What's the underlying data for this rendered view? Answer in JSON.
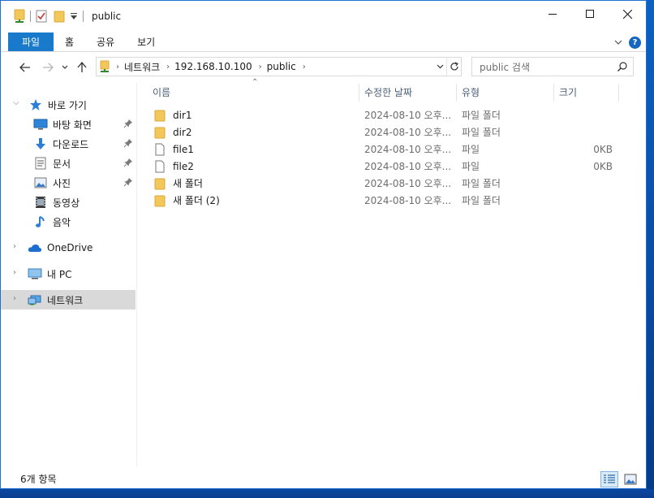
{
  "window": {
    "title": "public"
  },
  "ribbon": {
    "tabs": [
      "파일",
      "홈",
      "공유",
      "보기"
    ],
    "help": "?"
  },
  "address": {
    "crumbs": [
      "네트워크",
      "192.168.10.100",
      "public"
    ]
  },
  "search": {
    "placeholder": "public 검색"
  },
  "sidebar": {
    "quick_access": "바로 가기",
    "quick_items": [
      {
        "label": "바탕 화면",
        "icon": "desktop-icon",
        "pinned": true
      },
      {
        "label": "다운로드",
        "icon": "download-icon",
        "pinned": true
      },
      {
        "label": "문서",
        "icon": "document-icon",
        "pinned": true
      },
      {
        "label": "사진",
        "icon": "pictures-icon",
        "pinned": true
      },
      {
        "label": "동영상",
        "icon": "video-icon",
        "pinned": false
      },
      {
        "label": "음악",
        "icon": "music-icon",
        "pinned": false
      }
    ],
    "onedrive": "OneDrive",
    "this_pc": "내 PC",
    "network": "네트워크"
  },
  "columns": {
    "name": "이름",
    "date": "수정한 날짜",
    "type": "유형",
    "size": "크기"
  },
  "files": [
    {
      "name": "dir1",
      "date": "2024-08-10 오후...",
      "type": "파일 폴더",
      "size": "",
      "kind": "folder"
    },
    {
      "name": "dir2",
      "date": "2024-08-10 오후...",
      "type": "파일 폴더",
      "size": "",
      "kind": "folder"
    },
    {
      "name": "file1",
      "date": "2024-08-10 오후...",
      "type": "파일",
      "size": "0KB",
      "kind": "file"
    },
    {
      "name": "file2",
      "date": "2024-08-10 오후...",
      "type": "파일",
      "size": "0KB",
      "kind": "file"
    },
    {
      "name": "새 폴더",
      "date": "2024-08-10 오후...",
      "type": "파일 폴더",
      "size": "",
      "kind": "folder"
    },
    {
      "name": "새 폴더 (2)",
      "date": "2024-08-10 오후...",
      "type": "파일 폴더",
      "size": "",
      "kind": "folder"
    }
  ],
  "status": {
    "count": "6개 항목"
  },
  "colors": {
    "accent": "#1979ca",
    "folder": "#f3c85a",
    "selected": "#d9d9d9"
  }
}
